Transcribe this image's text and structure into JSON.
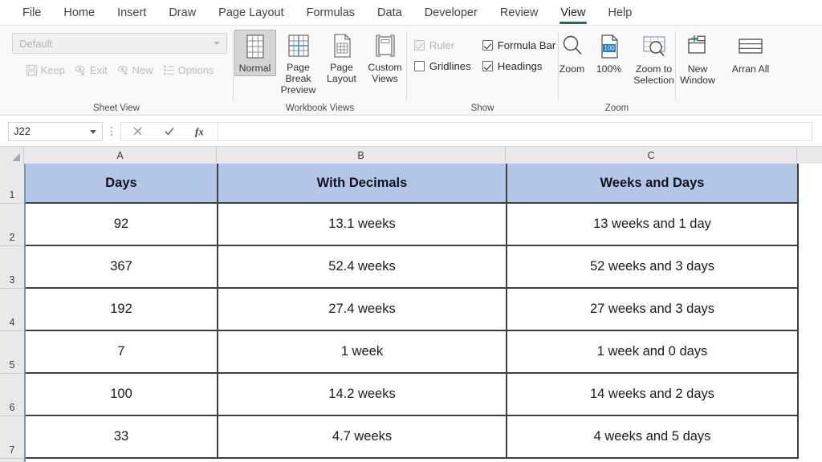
{
  "app": {
    "tabs": [
      {
        "label": "File",
        "active": false
      },
      {
        "label": "Home",
        "active": false
      },
      {
        "label": "Insert",
        "active": false
      },
      {
        "label": "Draw",
        "active": false
      },
      {
        "label": "Page Layout",
        "active": false
      },
      {
        "label": "Formulas",
        "active": false
      },
      {
        "label": "Data",
        "active": false
      },
      {
        "label": "Developer",
        "active": false
      },
      {
        "label": "Review",
        "active": false
      },
      {
        "label": "View",
        "active": true
      },
      {
        "label": "Help",
        "active": false
      }
    ],
    "active_tab_accent": "#217346"
  },
  "ribbon": {
    "sheet_view": {
      "group_title": "Sheet View",
      "combo_value": "Default",
      "buttons": [
        {
          "label": "Keep",
          "icon": "save-icon",
          "disabled": true
        },
        {
          "label": "Exit",
          "icon": "eye-exit-icon",
          "disabled": true
        },
        {
          "label": "New",
          "icon": "eye-new-icon",
          "disabled": true
        },
        {
          "label": "Options",
          "icon": "list-options-icon",
          "disabled": true
        }
      ]
    },
    "workbook_views": {
      "group_title": "Workbook Views",
      "items": [
        {
          "label": "Normal",
          "icon": "normal-view-icon",
          "selected": true
        },
        {
          "label": "Page Break Preview",
          "icon": "page-break-preview-icon",
          "selected": false
        },
        {
          "label": "Page Layout",
          "icon": "page-layout-icon",
          "selected": false
        },
        {
          "label": "Custom Views",
          "icon": "custom-views-icon",
          "selected": false
        }
      ]
    },
    "show": {
      "group_title": "Show",
      "checkboxes": [
        {
          "label": "Ruler",
          "checked": true,
          "disabled": true
        },
        {
          "label": "Formula Bar",
          "checked": true,
          "disabled": false
        },
        {
          "label": "Gridlines",
          "checked": false,
          "disabled": false
        },
        {
          "label": "Headings",
          "checked": true,
          "disabled": false
        }
      ]
    },
    "zoom": {
      "group_title": "Zoom",
      "items": [
        {
          "label": "Zoom",
          "icon": "magnifier-icon",
          "badge": ""
        },
        {
          "label": "100%",
          "icon": "zoom-100-icon",
          "badge": "100"
        },
        {
          "label": "Zoom to Selection",
          "icon": "zoom-to-selection-icon",
          "badge": ""
        }
      ]
    },
    "window": {
      "items": [
        {
          "label": "New Window",
          "icon": "new-window-icon"
        },
        {
          "label": "Arran All",
          "icon": "arrange-all-icon"
        }
      ]
    }
  },
  "formula_bar": {
    "name_box_value": "J22",
    "cancel_icon": "cancel-x-icon",
    "enter_icon": "enter-check-icon",
    "function_icon": "fx-icon",
    "formula_value": ""
  },
  "grid": {
    "column_headers": [
      "A",
      "B",
      "C"
    ],
    "row_headers": [
      "1",
      "2",
      "3",
      "4",
      "5",
      "6",
      "7"
    ],
    "header_fill": "#B4C6E7",
    "table": {
      "headers": [
        "Days",
        "With Decimals",
        "Weeks and Days"
      ],
      "rows": [
        [
          "92",
          "13.1 weeks",
          "13 weeks and 1 day"
        ],
        [
          "367",
          "52.4 weeks",
          "52 weeks and 3 days"
        ],
        [
          "192",
          "27.4 weeks",
          "27 weeks and 3 days"
        ],
        [
          "7",
          "1 week",
          "1 week and 0 days"
        ],
        [
          "100",
          "14.2 weeks",
          "14 weeks and 2 days"
        ],
        [
          "33",
          "4.7 weeks",
          "4 weeks and 5 days"
        ]
      ]
    }
  }
}
